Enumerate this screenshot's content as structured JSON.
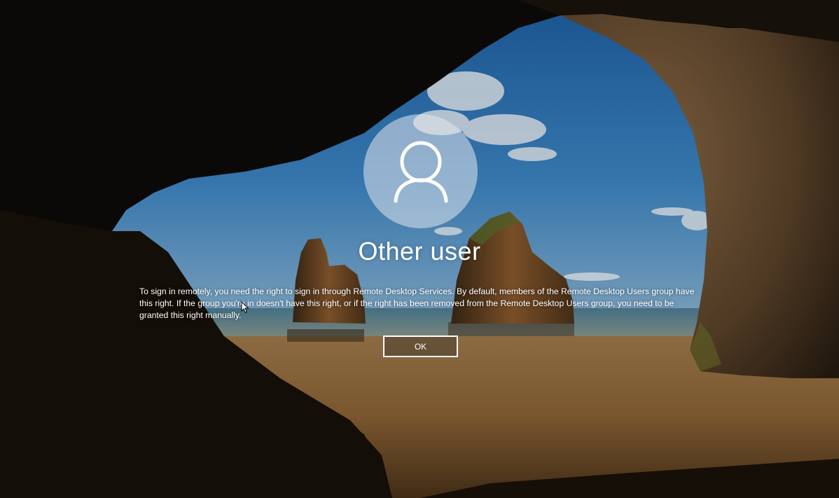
{
  "login": {
    "username": "Other user",
    "message": "To sign in remotely, you need the right to sign in through Remote Desktop Services. By default, members of the Remote Desktop Users group have this right. If the group you're in doesn't have this right, or if the right has been removed from the Remote Desktop Users group, you need to be granted this right manually.",
    "ok_label": "OK"
  },
  "icons": {
    "avatar": "user-silhouette-icon",
    "pointer": "mouse-cursor-icon"
  },
  "colors": {
    "text": "#ffffff",
    "avatar_circle": "#c9d3dc"
  }
}
